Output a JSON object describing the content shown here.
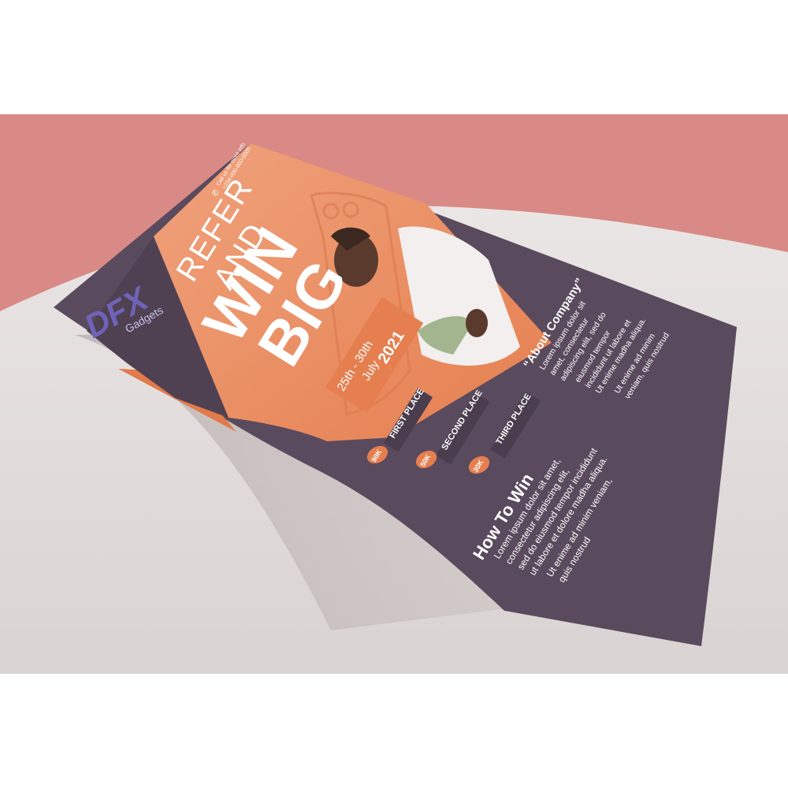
{
  "flyer": {
    "logo_mark": "DFX",
    "logo_sub": "Gadgets",
    "contact_line1": "Call us for more info",
    "contact_line2": "+234-000-000-0000",
    "headline_line1": "REFER",
    "headline_line2": "AND",
    "headline_line3": "WIN",
    "headline_line4": "BIG",
    "date_range": "25th - 30th",
    "date_month": "July",
    "date_year": "2021",
    "prizes": [
      {
        "place": "FIRST PLACE",
        "amount": "90K"
      },
      {
        "place": "SECOND PLACE",
        "amount": "50K"
      },
      {
        "place": "THIRD PLACE",
        "amount": "30K"
      }
    ],
    "about_title": "“About Company”",
    "about_lines": [
      "Lorem ipsum dolor sit",
      "amet, consectetur",
      "adipiscing elit, sed do",
      "eiusmod tempor",
      "incididunt ut labore et",
      "Ut enime madha aliqua.",
      "Ut enime ad minim",
      "veniam, quis nostrud"
    ],
    "howto_title": "How To Win",
    "howto_lines": [
      "Lorem ipsum dolor sit amet,",
      "consectetur adipiscing elit,",
      "sed do eiusmod tempor incididunt",
      "ut labore et dolore madha aliqua.",
      "Ut enime ad minim veniam,",
      "quis nostrud"
    ]
  },
  "colors": {
    "wall": "#d98a86",
    "surface": "#e3dedd",
    "flyer_dark": "#5a4a5d",
    "flyer_orange": "#ea8a5e",
    "logo_purple": "#6f63b8",
    "text_light": "#ffffff"
  }
}
